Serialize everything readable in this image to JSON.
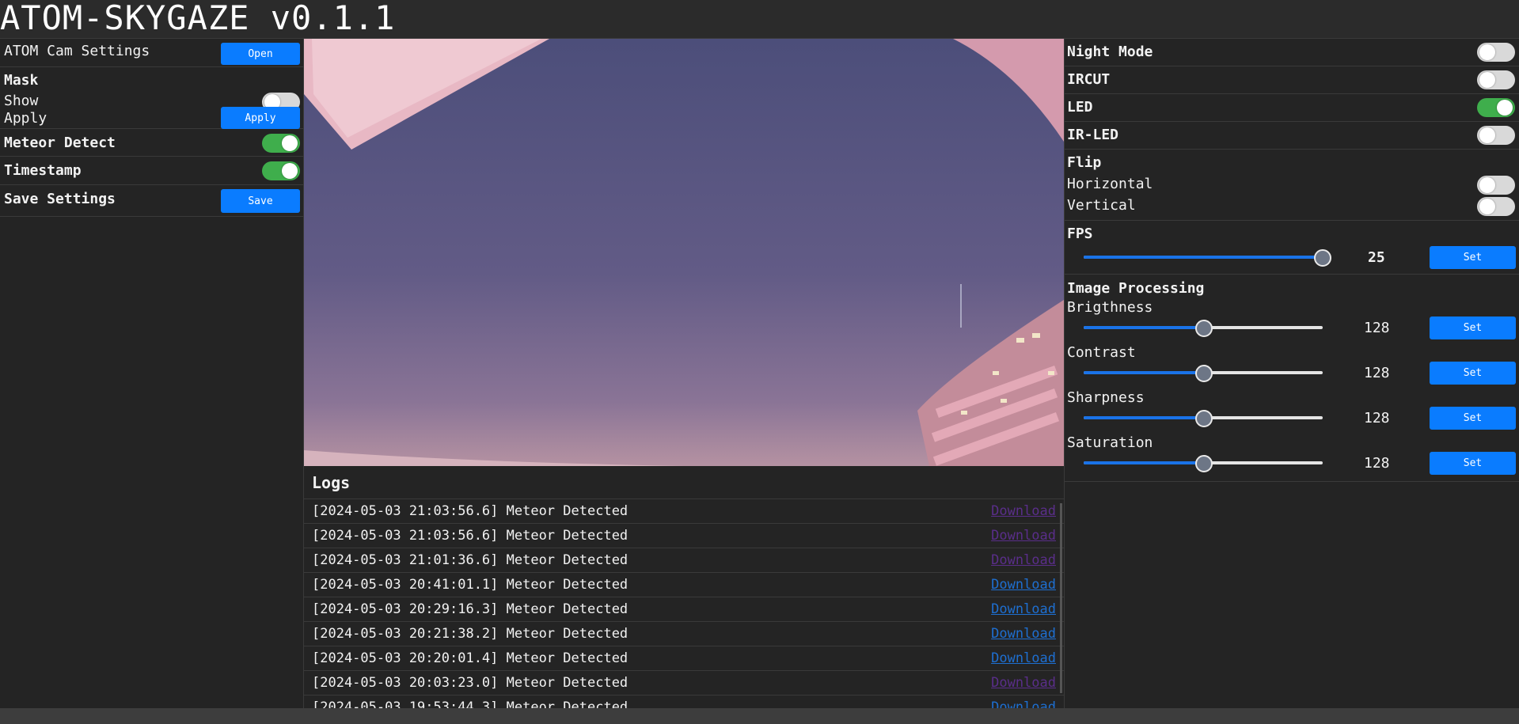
{
  "app": {
    "title": "ATOM-SKYGAZE v0.1.1"
  },
  "left": {
    "atom_cam": {
      "label": "ATOM Cam Settings",
      "button": "Open"
    },
    "mask": {
      "heading": "Mask",
      "show_label": "Show",
      "show_on": false,
      "apply_label": "Apply",
      "apply_button": "Apply"
    },
    "meteor_detect": {
      "label": "Meteor Detect",
      "on": true
    },
    "timestamp": {
      "label": "Timestamp",
      "on": true
    },
    "save": {
      "label": "Save Settings",
      "button": "Save"
    }
  },
  "right": {
    "night_mode": {
      "label": "Night Mode",
      "on": false
    },
    "ircut": {
      "label": "IRCUT",
      "on": false
    },
    "led": {
      "label": "LED",
      "on": true
    },
    "ir_led": {
      "label": "IR-LED",
      "on": false
    },
    "flip": {
      "heading": "Flip",
      "horizontal_label": "Horizontal",
      "horizontal_on": false,
      "vertical_label": "Vertical",
      "vertical_on": false
    },
    "fps": {
      "heading": "FPS",
      "value": "25",
      "level": 1.0,
      "button": "Set"
    },
    "image_processing": {
      "heading": "Image Processing",
      "items": [
        {
          "label": "Brigthness",
          "value": "128",
          "level": 0.502,
          "button": "Set"
        },
        {
          "label": "Contrast",
          "value": "128",
          "level": 0.502,
          "button": "Set"
        },
        {
          "label": "Sharpness",
          "value": "128",
          "level": 0.502,
          "button": "Set"
        },
        {
          "label": "Saturation",
          "value": "128",
          "level": 0.502,
          "button": "Set"
        }
      ]
    }
  },
  "logs": {
    "heading": "Logs",
    "link_label": "Download",
    "entries": [
      {
        "text": "[2024-05-03 21:03:56.6] Meteor Detected",
        "visited": true
      },
      {
        "text": "[2024-05-03 21:03:56.6] Meteor Detected",
        "visited": true
      },
      {
        "text": "[2024-05-03 21:01:36.6] Meteor Detected",
        "visited": true
      },
      {
        "text": "[2024-05-03 20:41:01.1] Meteor Detected",
        "visited": false
      },
      {
        "text": "[2024-05-03 20:29:16.3] Meteor Detected",
        "visited": false
      },
      {
        "text": "[2024-05-03 20:21:38.2] Meteor Detected",
        "visited": false
      },
      {
        "text": "[2024-05-03 20:20:01.4] Meteor Detected",
        "visited": false
      },
      {
        "text": "[2024-05-03 20:03:23.0] Meteor Detected",
        "visited": true
      },
      {
        "text": "[2024-05-03 19:53:44.3] Meteor Detected",
        "visited": false
      }
    ]
  },
  "colors": {
    "accent": "#0a7cff",
    "toggle_on": "#3fae4c",
    "link": "#1e6fd1",
    "link_visited": "#5a2e8a"
  }
}
